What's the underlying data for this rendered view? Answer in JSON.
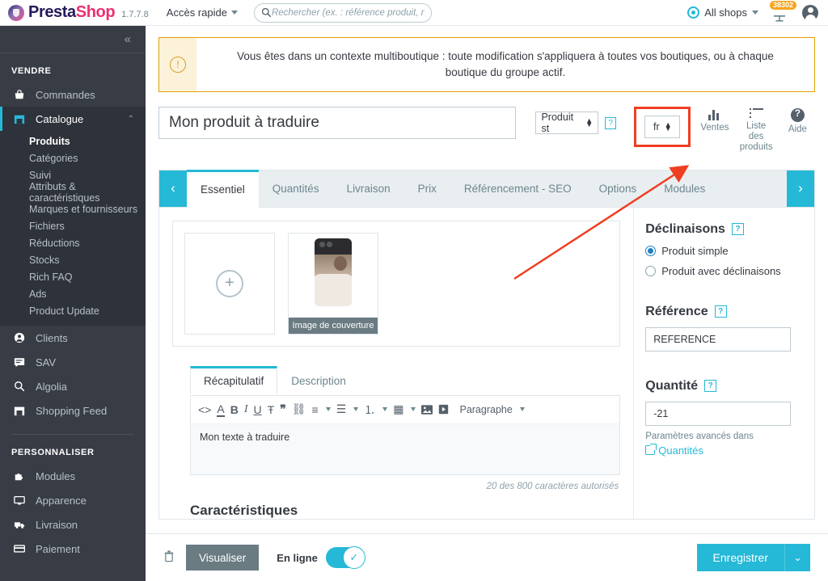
{
  "topbar": {
    "brand_presta": "Presta",
    "brand_shop": "Shop",
    "version": "1.7.7.8",
    "quick_access": "Accès rapide",
    "search_placeholder": "Rechercher (ex. : référence produit, nom",
    "search_value": "",
    "all_shops": "All shops",
    "cart_badge": "38302"
  },
  "sidebar": {
    "collapse_glyph": "«",
    "section_sell": "VENDRE",
    "section_customize": "PERSONNALISER",
    "items_sell": [
      {
        "label": "Commandes",
        "icon": "basket-icon"
      },
      {
        "label": "Catalogue",
        "icon": "store-icon"
      }
    ],
    "catalogue_sub": [
      "Produits",
      "Catégories",
      "Suivi",
      "Attributs & caractéristiques",
      "Marques et fournisseurs",
      "Fichiers",
      "Réductions",
      "Stocks",
      "Rich FAQ",
      "Ads",
      "Product Update"
    ],
    "items_sell2": [
      {
        "label": "Clients",
        "icon": "user-icon"
      },
      {
        "label": "SAV",
        "icon": "chat-icon"
      },
      {
        "label": "Algolia",
        "icon": "search-icon"
      },
      {
        "label": "Shopping Feed",
        "icon": "store-icon"
      }
    ],
    "items_customize": [
      {
        "label": "Modules",
        "icon": "puzzle-icon"
      },
      {
        "label": "Apparence",
        "icon": "monitor-icon"
      },
      {
        "label": "Livraison",
        "icon": "truck-icon"
      },
      {
        "label": "Paiement",
        "icon": "card-icon"
      }
    ]
  },
  "alert": {
    "text": "Vous êtes dans un contexte multiboutique : toute modification s'appliquera à toutes vos boutiques, ou à chaque boutique du groupe actif."
  },
  "header": {
    "product_title": "Mon produit à traduire",
    "product_type": "Produit st",
    "language": "fr",
    "tool_sales": "Ventes",
    "tool_list": "Liste des produits",
    "tool_help": "Aide",
    "help_badge": "?"
  },
  "tabs": {
    "prev": "‹",
    "next": "›",
    "items": [
      "Essentiel",
      "Quantités",
      "Livraison",
      "Prix",
      "Référencement - SEO",
      "Options",
      "Modules"
    ],
    "active_index": 0
  },
  "images": {
    "add_label": "+",
    "cover_label": "Image de couverture"
  },
  "editor": {
    "tabs": [
      "Récapitulatif",
      "Description"
    ],
    "active_tab": "Récapitulatif",
    "toolbar": [
      {
        "name": "source-code-icon",
        "glyph": "<>"
      },
      {
        "name": "text-color-icon",
        "glyph": "A"
      },
      {
        "name": "bold-icon",
        "glyph": "B"
      },
      {
        "name": "italic-icon",
        "glyph": "I"
      },
      {
        "name": "underline-icon",
        "glyph": "U"
      },
      {
        "name": "strikethrough-icon",
        "glyph": "Ŧ"
      },
      {
        "name": "blockquote-icon",
        "glyph": "❞"
      },
      {
        "name": "link-icon",
        "glyph": "⛓"
      },
      {
        "name": "align-icon",
        "glyph": "≡"
      },
      {
        "name": "bullet-list-icon",
        "glyph": "☰"
      },
      {
        "name": "numbered-list-icon",
        "glyph": "⒈"
      },
      {
        "name": "table-icon",
        "glyph": "▦"
      },
      {
        "name": "image-icon",
        "glyph": "🖼"
      },
      {
        "name": "video-icon",
        "glyph": "▶"
      }
    ],
    "paragraph_label": "Paragraphe",
    "content": "Mon texte à traduire",
    "char_count": "20 des 800 caractères autorisés"
  },
  "features": {
    "title": "Caractéristiques"
  },
  "right_panel": {
    "declinaisons_title": "Déclinaisons",
    "help_badge": "?",
    "radio_simple": "Produit simple",
    "radio_variants": "Produit avec déclinaisons",
    "selected_radio": "Produit simple",
    "reference_title": "Référence",
    "reference_value": "REFERENCE",
    "quantity_title": "Quantité",
    "quantity_value": "-21",
    "advanced_note": "Paramètres avancés dans",
    "advanced_link": "Quantités"
  },
  "footer": {
    "delete_icon": "trash-icon",
    "preview_label": "Visualiser",
    "online_label": "En ligne",
    "online_state": "on",
    "save_label": "Enregistrer",
    "save_dropdown": "⌄"
  },
  "annotation": {
    "highlight_color": "#f03e20",
    "target": "language-selector"
  },
  "colors": {
    "accent": "#25b9d7",
    "sidebar_bg": "#383c45",
    "alert_border": "#e0a200",
    "brand_pink": "#ee2f72",
    "brand_navy": "#251b5b"
  }
}
